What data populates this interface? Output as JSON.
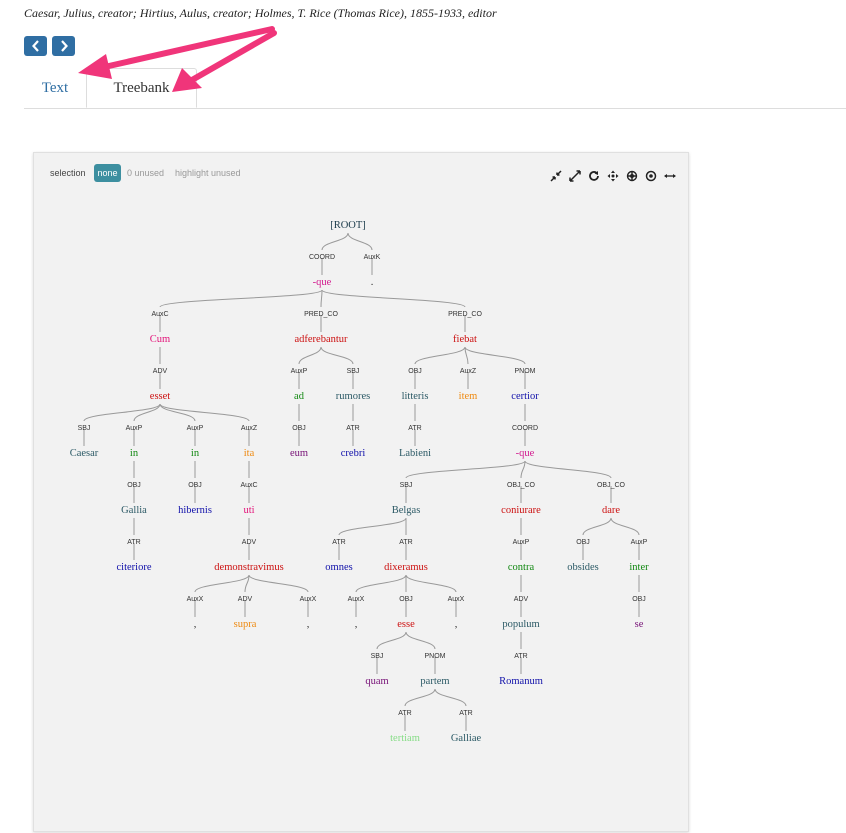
{
  "attribution": "Caesar, Julius, creator; Hirtius, Aulus, creator; Holmes, T. Rice (Thomas Rice), 1855-1933, editor",
  "nav": {
    "prev_icon": "chevron-left-icon",
    "next_icon": "chevron-right-icon"
  },
  "tabs": [
    {
      "label": "Text",
      "active": false
    },
    {
      "label": "Treebank",
      "active": true
    }
  ],
  "annotation_color": "#f0357a",
  "selection": {
    "label": "selection",
    "badge": "none",
    "unused": "0 unused",
    "highlight": "highlight unused"
  },
  "toolbar_icons": [
    "collapse-icon",
    "expand-icon",
    "refresh-icon",
    "move-icon",
    "center-icon",
    "focus-icon",
    "horizontal-resize-icon"
  ],
  "tree": {
    "nodes": [
      {
        "id": "root",
        "word": "[ROOT]",
        "label": "",
        "color": "#1a3a4a"
      },
      {
        "id": "que1",
        "word": "-que",
        "label": "COORD",
        "color": "#d21b8f",
        "parent": "root"
      },
      {
        "id": "period",
        "word": ".",
        "label": "AuxK",
        "color": "#333333",
        "parent": "root"
      },
      {
        "id": "cum",
        "word": "Cum",
        "label": "AuxC",
        "color": "#e3157a",
        "parent": "que1"
      },
      {
        "id": "adfereb",
        "word": "adferebantur",
        "label": "PRED_CO",
        "color": "#cc1111",
        "parent": "que1"
      },
      {
        "id": "fiebat",
        "word": "fiebat",
        "label": "PRED_CO",
        "color": "#cc1111",
        "parent": "que1"
      },
      {
        "id": "esset",
        "word": "esset",
        "label": "ADV",
        "color": "#cc1111",
        "parent": "cum"
      },
      {
        "id": "caesar",
        "word": "Caesar",
        "label": "SBJ",
        "color": "#2c5a66",
        "parent": "esset"
      },
      {
        "id": "in1",
        "word": "in",
        "label": "AuxP",
        "color": "#118811",
        "parent": "esset"
      },
      {
        "id": "in2",
        "word": "in",
        "label": "AuxP",
        "color": "#118811",
        "parent": "esset"
      },
      {
        "id": "ita",
        "word": "ita",
        "label": "AuxZ",
        "color": "#ee8a11",
        "parent": "esset"
      },
      {
        "id": "gallia",
        "word": "Gallia",
        "label": "OBJ",
        "color": "#2c5a66",
        "parent": "in1"
      },
      {
        "id": "citeriore",
        "word": "citeriore",
        "label": "ATR",
        "color": "#1111aa",
        "parent": "gallia"
      },
      {
        "id": "hibernis",
        "word": "hibernis",
        "label": "OBJ",
        "color": "#1111aa",
        "parent": "in2"
      },
      {
        "id": "uti",
        "word": "uti",
        "label": "AuxC",
        "color": "#e3157a",
        "parent": "ita"
      },
      {
        "id": "demonstr",
        "word": "demonstravimus",
        "label": "ADV",
        "color": "#cc1111",
        "parent": "uti"
      },
      {
        "id": "comma1",
        "word": ",",
        "label": "AuxX",
        "color": "#333333",
        "parent": "demonstr"
      },
      {
        "id": "supra",
        "word": "supra",
        "label": "ADV",
        "color": "#ee8a11",
        "parent": "demonstr"
      },
      {
        "id": "comma2",
        "word": ",",
        "label": "AuxX",
        "color": "#333333",
        "parent": "demonstr"
      },
      {
        "id": "ad",
        "word": "ad",
        "label": "AuxP",
        "color": "#118811",
        "parent": "adfereb"
      },
      {
        "id": "rumores",
        "word": "rumores",
        "label": "SBJ",
        "color": "#2c5a66",
        "parent": "adfereb"
      },
      {
        "id": "eum",
        "word": "eum",
        "label": "OBJ",
        "color": "#771177",
        "parent": "ad"
      },
      {
        "id": "crebri",
        "word": "crebri",
        "label": "ATR",
        "color": "#1111aa",
        "parent": "rumores"
      },
      {
        "id": "litteris",
        "word": "litteris",
        "label": "OBJ",
        "color": "#2c5a66",
        "parent": "fiebat"
      },
      {
        "id": "item",
        "word": "item",
        "label": "AuxZ",
        "color": "#ee8a11",
        "parent": "fiebat"
      },
      {
        "id": "certior",
        "word": "certior",
        "label": "PNOM",
        "color": "#1111aa",
        "parent": "fiebat"
      },
      {
        "id": "labieni",
        "word": "Labieni",
        "label": "ATR",
        "color": "#2c5a66",
        "parent": "litteris"
      },
      {
        "id": "que2",
        "word": "-que",
        "label": "COORD",
        "color": "#d21b8f",
        "parent": "certior"
      },
      {
        "id": "belgas",
        "word": "Belgas",
        "label": "SBJ",
        "color": "#2c5a66",
        "parent": "que2"
      },
      {
        "id": "coniurare",
        "word": "coniurare",
        "label": "OBJ_CO",
        "color": "#cc1111",
        "parent": "que2"
      },
      {
        "id": "dare",
        "word": "dare",
        "label": "OBJ_CO",
        "color": "#cc1111",
        "parent": "que2"
      },
      {
        "id": "omnes",
        "word": "omnes",
        "label": "ATR",
        "color": "#1111aa",
        "parent": "belgas"
      },
      {
        "id": "dixeramus",
        "word": "dixeramus",
        "label": "ATR",
        "color": "#cc1111",
        "parent": "belgas"
      },
      {
        "id": "comma3",
        "word": ",",
        "label": "AuxX",
        "color": "#333333",
        "parent": "dixeramus"
      },
      {
        "id": "esse",
        "word": "esse",
        "label": "OBJ",
        "color": "#cc1111",
        "parent": "dixeramus"
      },
      {
        "id": "comma4",
        "word": ",",
        "label": "AuxX",
        "color": "#333333",
        "parent": "dixeramus"
      },
      {
        "id": "quam",
        "word": "quam",
        "label": "SBJ",
        "color": "#771177",
        "parent": "esse"
      },
      {
        "id": "partem",
        "word": "partem",
        "label": "PNOM",
        "color": "#2c5a66",
        "parent": "esse"
      },
      {
        "id": "tertiam",
        "word": "tertiam",
        "label": "ATR",
        "color": "#88dd88",
        "parent": "partem"
      },
      {
        "id": "galliae",
        "word": "Galliae",
        "label": "ATR",
        "color": "#2c5a66",
        "parent": "partem"
      },
      {
        "id": "contra",
        "word": "contra",
        "label": "AuxP",
        "color": "#118811",
        "parent": "coniurare"
      },
      {
        "id": "populum",
        "word": "populum",
        "label": "ADV",
        "color": "#2c5a66",
        "parent": "contra"
      },
      {
        "id": "romanum",
        "word": "Romanum",
        "label": "ATR",
        "color": "#1111aa",
        "parent": "populum"
      },
      {
        "id": "obsides",
        "word": "obsides",
        "label": "OBJ",
        "color": "#2c5a66",
        "parent": "dare"
      },
      {
        "id": "inter",
        "word": "inter",
        "label": "AuxP",
        "color": "#118811",
        "parent": "dare"
      },
      {
        "id": "se",
        "word": "se",
        "label": "OBJ",
        "color": "#771177",
        "parent": "inter"
      }
    ]
  }
}
